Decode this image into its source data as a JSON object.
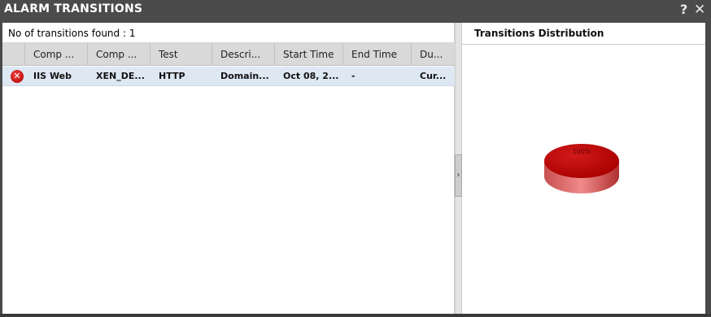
{
  "window": {
    "title": "ALARM TRANSITIONS",
    "help_icon": "?",
    "close_icon": "✕"
  },
  "summary": {
    "count_text": "No of transitions found : 1"
  },
  "table": {
    "columns": [
      "Comp ...",
      "Comp ...",
      "Test",
      "Descri...",
      "Start Time",
      "End Time",
      "Du..."
    ],
    "rows": [
      {
        "status_icon": "error-icon",
        "status_glyph": "✕",
        "cells": [
          "IIS Web",
          "XEN_DE...",
          "HTTP",
          "Domain...",
          "Oct 08, 2...",
          "-",
          "Cur..."
        ]
      }
    ]
  },
  "distribution": {
    "title": "Transitions Distribution",
    "chart_data": {
      "type": "pie",
      "slices": [
        {
          "label": "100%",
          "value": 100,
          "color": "#c00000"
        }
      ]
    }
  },
  "colors": {
    "titlebar": "#4b4b4b",
    "header_bg": "#d9d9d9",
    "selected_row": "#dde8f3",
    "critical": "#c00000"
  }
}
